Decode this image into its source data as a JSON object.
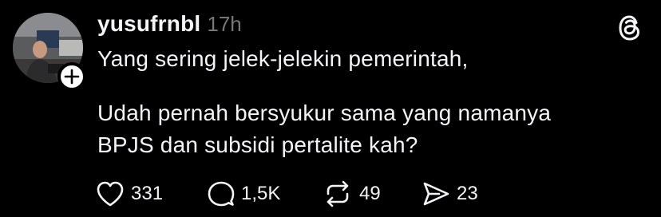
{
  "post": {
    "author": {
      "username": "yusufrnbl",
      "time": "17h"
    },
    "text_lines": [
      "Yang sering jelek-jelekin pemerintah,",
      "Udah pernah bersyukur sama yang namanya",
      "BPJS dan subsidi pertalite kah?"
    ],
    "actions": {
      "likes": "331",
      "replies": "1,5K",
      "reposts": "49",
      "shares": "23"
    }
  },
  "icons": {
    "app_logo": "threads-logo-icon",
    "follow": "plus-icon",
    "like": "heart-icon",
    "reply": "comment-bubble-icon",
    "repost": "repost-arrows-icon",
    "share": "send-icon"
  },
  "colors": {
    "background": "#000000",
    "text": "#f3f5f7",
    "secondary_text": "#777777"
  }
}
